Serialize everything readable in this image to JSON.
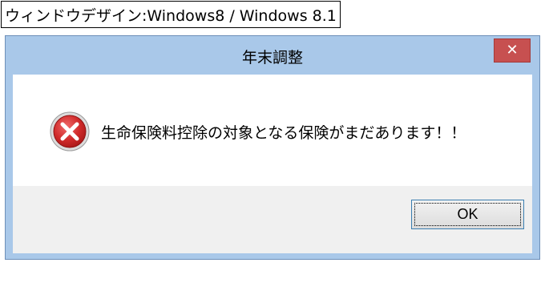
{
  "caption": {
    "text": "ウィンドウデザイン:Windows8 / Windows 8.1"
  },
  "dialog": {
    "title": "年末調整",
    "close_icon": "close-icon",
    "message": "生命保険料控除の対象となる保険がまだあります！！",
    "icon": "error-icon",
    "ok_label": "OK"
  },
  "colors": {
    "title_bar": "#a9c8e9",
    "close_button": "#c75050",
    "content_bg": "#ffffff",
    "footer_bg": "#f0f0f0",
    "error_red": "#d02a2a"
  }
}
